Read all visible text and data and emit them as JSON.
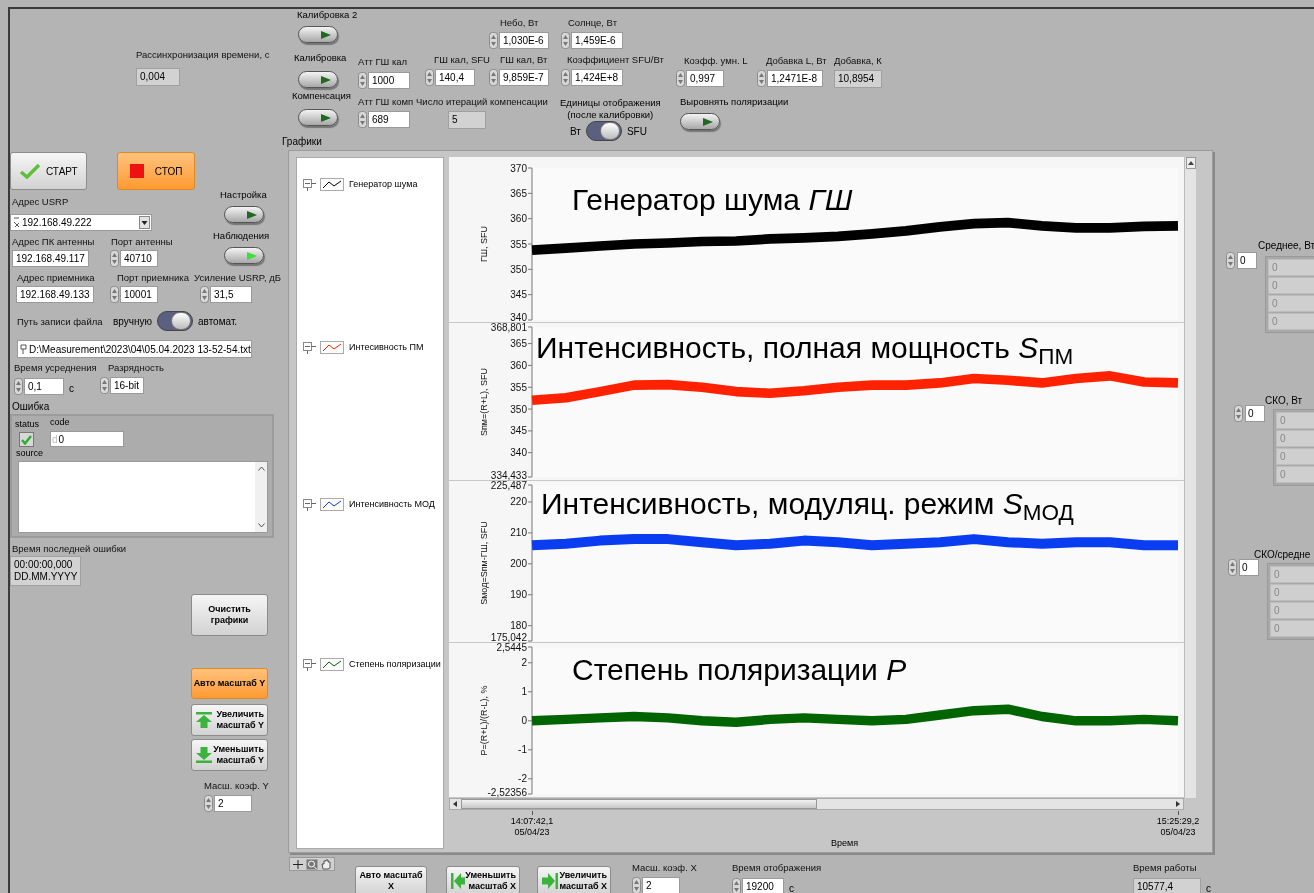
{
  "fields": [
    {
      "label": "Рассинхронизация времени, с",
      "value": "0,004",
      "kind": "indicator"
    },
    {
      "label": "Небо, Вт",
      "value": "1,030E-6",
      "kind": "numeric"
    },
    {
      "label": "Солнце, Вт",
      "value": "1,459E-6",
      "kind": "numeric"
    },
    {
      "label": "Атт ГШ кал",
      "value": "1000",
      "kind": "numeric"
    },
    {
      "label": "ГШ кал, SFU",
      "value": "140,4",
      "kind": "numeric"
    },
    {
      "label": "ГШ кал, Вт",
      "value": "9,859E-7",
      "kind": "numeric"
    },
    {
      "label": "Коэффициент SFU/Вт",
      "value": "1,424E+8",
      "kind": "numeric"
    },
    {
      "label": "Коэфф. умн. L",
      "value": "0,997",
      "kind": "numeric"
    },
    {
      "label": "Добавка L, Вт",
      "value": "1,2471E-8",
      "kind": "numeric"
    },
    {
      "label": "Добавка, К",
      "value": "10,8954",
      "kind": "indicator"
    },
    {
      "label": "Атт ГШ комп",
      "value": "689",
      "kind": "numeric"
    },
    {
      "label": "Число итераций компенсации",
      "value": "5",
      "kind": "indicator"
    },
    {
      "label": "Адрес USRP",
      "value": "192.168.49.222",
      "kind": "combo"
    },
    {
      "label": "Адрес ПК антенны",
      "value": "192.168.49.117",
      "kind": "string"
    },
    {
      "label": "Порт антенны",
      "value": "40710",
      "kind": "numeric"
    },
    {
      "label": "Адрес приемника",
      "value": "192.168.49.133",
      "kind": "string"
    },
    {
      "label": "Порт приемника",
      "value": "10001",
      "kind": "numeric"
    },
    {
      "label": "Усиление USRP, дБ",
      "value": "31,5",
      "kind": "numeric"
    },
    {
      "label": "Путь записи файла",
      "value": "D:\\Measurement\\2023\\04\\05.04.2023 13-52-54.txt",
      "kind": "path"
    },
    {
      "label": "Время усреднения",
      "value": "0,1",
      "unit": "с",
      "kind": "numeric"
    },
    {
      "label": "Разрядность",
      "value": "16-bit",
      "kind": "numeric"
    },
    {
      "label": "Время последней ошибки",
      "value": "00:00:00,000\nDD.MM.YYYY",
      "kind": "indicator"
    },
    {
      "label": "Масш. коэф. Y",
      "value": "2",
      "kind": "numeric"
    },
    {
      "label": "Масш. коэф. X",
      "value": "2",
      "kind": "numeric"
    },
    {
      "label": "Время отображения",
      "value": "19200",
      "unit": "с",
      "kind": "numeric"
    },
    {
      "label": "Время работы",
      "value": "10577,4",
      "unit": "с",
      "kind": "indicator"
    }
  ],
  "switches": [
    {
      "kind": "led",
      "label": "Калибровка 2",
      "on": false
    },
    {
      "kind": "led",
      "label": "Калибровка",
      "on": false
    },
    {
      "kind": "led",
      "label": "Компенсация",
      "on": false
    },
    {
      "kind": "led",
      "label": "Выровнять поляризации",
      "on": false
    },
    {
      "kind": "led",
      "label": "Настройка",
      "on": false
    },
    {
      "kind": "led",
      "label": "Наблюдения",
      "on": true
    },
    {
      "kind": "toggle",
      "label": "Единицы отображения\n(после калибровки)",
      "left": "Вт",
      "right": "SFU",
      "on": true
    },
    {
      "kind": "toggle",
      "left": "вручную",
      "right": "автомат.",
      "on": true
    }
  ],
  "buttons": [
    {
      "label": "СТАРТ",
      "kind": "check",
      "highlighted": false
    },
    {
      "label": "СТОП",
      "kind": "stop",
      "highlighted": true
    },
    {
      "label": "Очистить\nграфики",
      "kind": "plain",
      "highlighted": false
    },
    {
      "label": "Авто масштаб Y",
      "kind": "plain",
      "highlighted": true
    },
    {
      "label": "Увеличить\nмасштаб Y",
      "kind": "up",
      "highlighted": false
    },
    {
      "label": "Уменьшить\nмасштаб Y",
      "kind": "down",
      "highlighted": false
    },
    {
      "label": "Авто масштаб X",
      "kind": "plain",
      "highlighted": false
    },
    {
      "label": "Уменьшить\nмасштаб X",
      "kind": "left",
      "highlighted": false
    },
    {
      "label": "Увеличить\nмасштаб X",
      "kind": "right",
      "highlighted": false
    }
  ],
  "error": {
    "title": "Ошибка",
    "status_label": "status",
    "status_ok": true,
    "code_label": "code",
    "code_radix": "d",
    "code": "0",
    "source_label": "source"
  },
  "arrays": [
    {
      "label": "Среднее, Вт",
      "index": "0",
      "values": [
        "0",
        "0",
        "0",
        "0"
      ]
    },
    {
      "label": "СКО, Вт",
      "index": "0",
      "values": [
        "0",
        "0",
        "0",
        "0"
      ]
    },
    {
      "label": "СКО/средне",
      "index": "0",
      "values": [
        "0",
        "0",
        "0",
        "0"
      ]
    }
  ],
  "graphs": {
    "label": "Графики",
    "charts": [
      {
        "chart_data": {
          "type": "line",
          "title": "Генератор шума *ГШ*",
          "ylabel": "ГШ, SFU",
          "ylim": [
            340,
            370
          ],
          "yticks": [
            340,
            345,
            350,
            355,
            360,
            365,
            370
          ],
          "series": [
            {
              "name": "Генератор шума",
              "color": "#000000",
              "values": [
                353.8,
                354.2,
                354.6,
                355,
                355.2,
                355.5,
                355.6,
                356,
                356.2,
                356.5,
                357,
                357.6,
                358.4,
                359,
                359.2,
                358.6,
                358.2,
                358.2,
                358.5,
                358.6
              ]
            }
          ]
        }
      },
      {
        "chart_data": {
          "type": "line",
          "title": "Интенсивность, полная мощность *S*$_{ПМ}$",
          "ylabel": "Sпм=(R+L), SFU",
          "ylim": [
            334.433,
            368.801
          ],
          "yticks": [
            {
              "value": 334.433,
              "label": "334,433"
            },
            340,
            345,
            350,
            355,
            360,
            365,
            {
              "value": 368.801,
              "label": "368,801"
            }
          ],
          "series": [
            {
              "name": "Интесивность ПМ",
              "color": "#ff2200",
              "values": [
                352,
                352.6,
                354,
                355.5,
                355.6,
                355,
                354,
                353.6,
                354.2,
                355,
                355.5,
                355.5,
                356,
                357,
                356.6,
                356,
                357,
                357.6,
                356.2,
                356
              ]
            }
          ]
        }
      },
      {
        "chart_data": {
          "type": "line",
          "title": "Интенсивность, модуляц. режим *S*$_{МОД}$",
          "ylabel": "Sмод=Sпм-ГШ, SFU",
          "ylim": [
            175.042,
            225.487
          ],
          "yticks": [
            {
              "value": 175.042,
              "label": "175,042"
            },
            180,
            190,
            200,
            210,
            220,
            {
              "value": 225.487,
              "label": "225,487"
            }
          ],
          "series": [
            {
              "name": "Интенсивность МОД",
              "color": "#0a3cf0",
              "values": [
                206,
                206.5,
                207.5,
                208,
                208,
                207,
                206,
                206.5,
                207.5,
                207,
                206,
                206.5,
                207,
                208,
                207,
                206.5,
                207,
                207,
                206,
                206
              ]
            }
          ]
        }
      },
      {
        "chart_data": {
          "type": "line",
          "title": "Степень поляризации *P*",
          "ylabel": "P=(R+L)/(R-L), %",
          "ylim": [
            -2.52356,
            2.5445
          ],
          "yticks": [
            {
              "value": -2.52356,
              "label": "-2,52356"
            },
            -2,
            -1,
            0,
            1,
            2,
            {
              "value": 2.5445,
              "label": "2,5445"
            }
          ],
          "series": [
            {
              "name": "Степень поляризации",
              "color": "#006400",
              "values": [
                0,
                0.05,
                0.1,
                0.15,
                0.1,
                0,
                -0.05,
                0.05,
                0.1,
                0.05,
                0,
                0.05,
                0.2,
                0.35,
                0.4,
                0.15,
                0,
                0,
                0.05,
                0
              ]
            }
          ]
        }
      }
    ],
    "time_axis": {
      "label": "Время",
      "ticks": [
        {
          "time": "14:07:42,1",
          "date": "05/04/23"
        },
        {
          "time": "15:25:29,2",
          "date": "05/04/23"
        }
      ]
    }
  }
}
